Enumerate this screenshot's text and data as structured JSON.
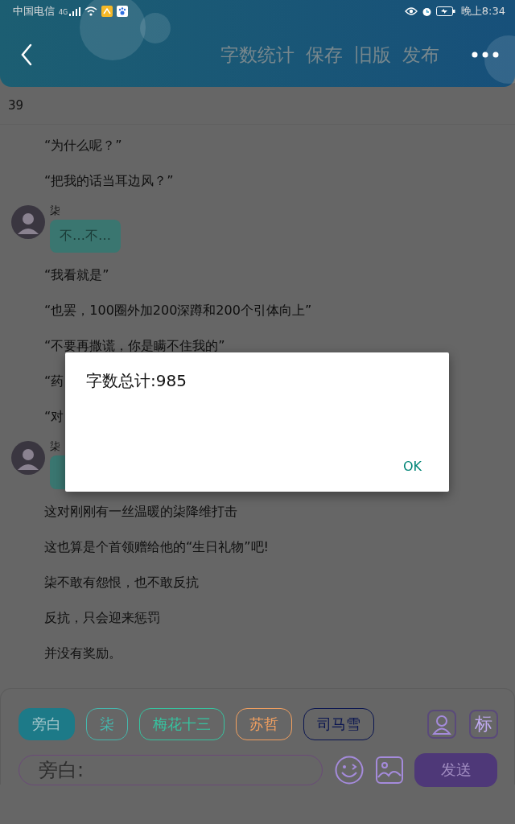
{
  "status_bar": {
    "carrier": "中国电信",
    "network": "4G",
    "time": "晚上8:34"
  },
  "header": {
    "actions": [
      "字数统计",
      "保存",
      "旧版",
      "发布"
    ]
  },
  "chapter": "39",
  "messages": [
    {
      "kind": "narration",
      "text": "“为什么呢？”"
    },
    {
      "kind": "narration",
      "text": "“把我的话当耳边风？”"
    },
    {
      "kind": "dialogue",
      "speaker": "柒",
      "text": "不…不…"
    },
    {
      "kind": "narration",
      "text": "“我看就是”"
    },
    {
      "kind": "narration",
      "text": "“也罢，100圈外加200深蹲和200个引体向上”"
    },
    {
      "kind": "narration",
      "text": "“不要再撒谎，你是瞒不住我的”"
    },
    {
      "kind": "narration",
      "text": "“药"
    },
    {
      "kind": "narration",
      "text": "“对"
    },
    {
      "kind": "dialogue",
      "speaker": "柒"
    },
    {
      "kind": "narration",
      "text": "这对刚刚有一丝温暖的柒降维打击"
    },
    {
      "kind": "narration",
      "text": "这也算是个首领赠给他的“生日礼物”吧!"
    },
    {
      "kind": "narration",
      "text": "柒不敢有怨恨，也不敢反抗"
    },
    {
      "kind": "narration",
      "text": "反抗，只会迎来惩罚"
    },
    {
      "kind": "narration",
      "text": "并没有奖励。"
    }
  ],
  "composer": {
    "chips": [
      {
        "label": "旁白",
        "color": "#1d7a88",
        "selected": true
      },
      {
        "label": "柒",
        "color": "#45b8ae",
        "selected": false
      },
      {
        "label": "梅花十三",
        "color": "#36c4a0",
        "selected": false
      },
      {
        "label": "苏哲",
        "color": "#f2a060",
        "selected": false
      },
      {
        "label": "司马雪",
        "color": "#0a1550",
        "selected": false
      }
    ],
    "tag_button": "标",
    "placeholder": "旁白:",
    "send": "发送"
  },
  "dialog": {
    "message": "字数总计:985",
    "button": "OK"
  }
}
